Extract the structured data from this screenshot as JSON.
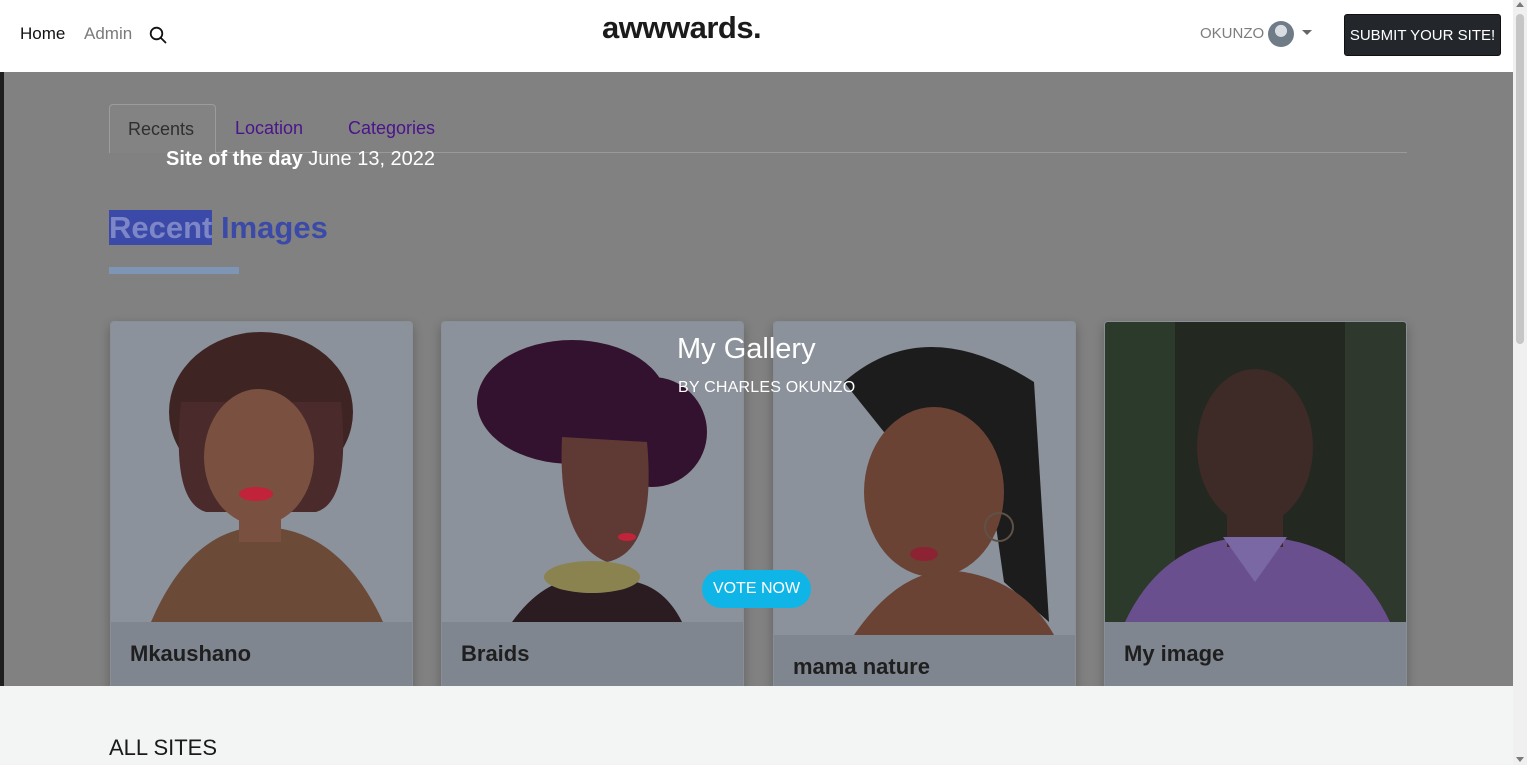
{
  "navbar": {
    "home": "Home",
    "admin": "Admin",
    "brand": "awwwards.",
    "username": "OKUNZO",
    "submit": "SUBMIT YOUR SITE!"
  },
  "tabs": [
    {
      "label": "Recents"
    },
    {
      "label": "Location"
    },
    {
      "label": "Categories"
    }
  ],
  "site_of_day": {
    "label": "Site of the day",
    "date": "June 13, 2022"
  },
  "heading": {
    "word1": "Recent",
    "word2": "Images"
  },
  "gallery": {
    "title": "My Gallery",
    "by": "BY CHARLES OKUNZO",
    "vote": "VOTE NOW"
  },
  "cards": [
    {
      "title": "Mkaushano"
    },
    {
      "title": "Braids"
    },
    {
      "title": "mama nature"
    },
    {
      "title": "My image"
    }
  ],
  "all_sites": "ALL SITES",
  "colors": {
    "accent": "#0fb5e6",
    "tab_link": "#4a148c",
    "heading": "#3b4aa8",
    "submit_bg": "#23272b"
  }
}
